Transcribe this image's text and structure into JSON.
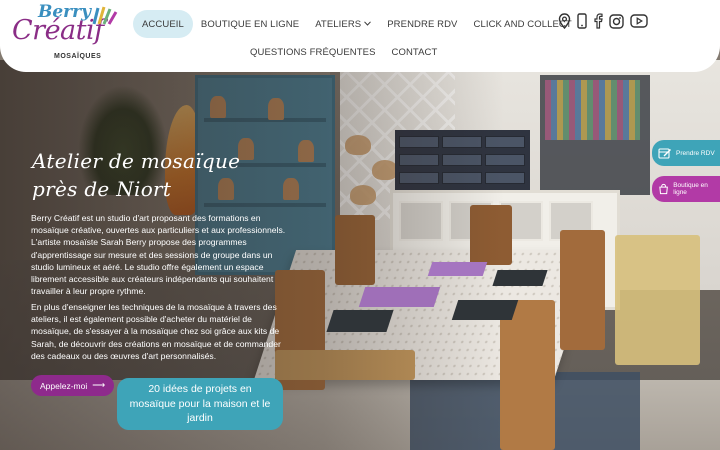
{
  "logo": {
    "line1": "Berry",
    "line2": "Créatif",
    "line3": "MOSAÏQUES"
  },
  "nav": {
    "items": [
      {
        "label": "ACCUEIL",
        "active": true
      },
      {
        "label": "BOUTIQUE EN LIGNE"
      },
      {
        "label": "ATELIERS",
        "has_dropdown": true
      },
      {
        "label": "PRENDRE RDV"
      },
      {
        "label": "CLICK AND COLLECT"
      },
      {
        "label": "QUESTIONS FRÉQUENTES"
      },
      {
        "label": "CONTACT"
      }
    ]
  },
  "social_icons": [
    "location-pin-icon",
    "phone-icon",
    "facebook-icon",
    "instagram-icon",
    "youtube-icon"
  ],
  "hero": {
    "title": "Atelier de mosaïque près de Niort",
    "paragraph1": "Berry Créatif est un studio d'art proposant des formations en mosaïque créative, ouvertes aux particuliers et aux professionnels. L'artiste mosaïste Sarah Berry propose des programmes d'apprentissage sur mesure et des sessions de groupe dans un studio lumineux et aéré. Le studio offre également un espace librement accessible aux créateurs indépendants qui souhaitent travailler à leur propre rythme.",
    "paragraph2": "En plus d'enseigner les techniques de la mosaïque à travers des ateliers, il est également possible d'acheter du matériel de mosaïque, de s'essayer à la mosaïque chez soi grâce aux kits de Sarah, de découvrir des créations en mosaïque et de commander des cadeaux ou des œuvres d'art personnalisés.",
    "call_button": "Appelez-moi",
    "call_arrow": "⟶",
    "ideas_button": "20 idées de projets en mosaïque pour la maison et le jardin"
  },
  "side_tabs": {
    "rdv": "Prendre RDV",
    "shop": "Boutique en ligne"
  },
  "colors": {
    "brand_purple": "#8e2a8c",
    "brand_teal": "#3ea4b8",
    "active_nav_bg": "#d6ecf3"
  }
}
